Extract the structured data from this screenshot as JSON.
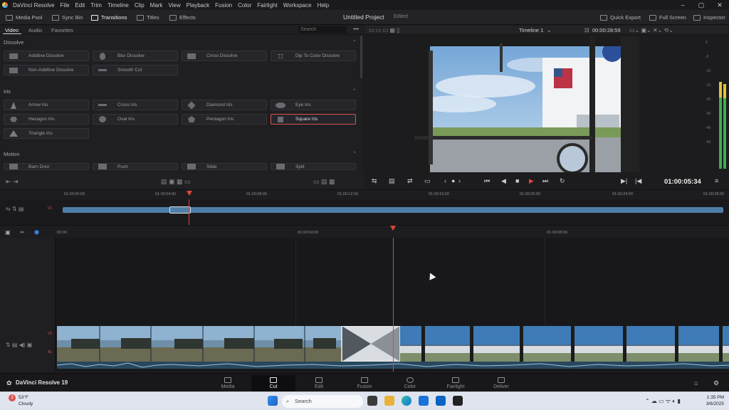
{
  "menubar": {
    "app_name": "DaVinci Resolve",
    "items": [
      "File",
      "Edit",
      "Trim",
      "Timeline",
      "Clip",
      "Mark",
      "View",
      "Playback",
      "Fusion",
      "Color",
      "Fairlight",
      "Workspace",
      "Help"
    ]
  },
  "toolbar": {
    "media_pool": "Media Pool",
    "sync_bin": "Sync Bin",
    "transitions": "Transitions",
    "titles": "Titles",
    "effects": "Effects",
    "project_title": "Untitled Project",
    "project_status": "Edited",
    "quick_export": "Quick Export",
    "full_screen": "Full Screen",
    "inspector": "Inspector"
  },
  "effects_panel": {
    "tabs": [
      "Video",
      "Audio",
      "Favorites"
    ],
    "search_placeholder": "Search",
    "sections": {
      "dissolve": "Dissolve",
      "iris": "Iris",
      "motion": "Motion"
    },
    "dissolve_items": [
      "Additive Dissolve",
      "Blur Dissolve",
      "Cross Dissolve",
      "Dip To Color Dissolve",
      "Non-Additive Dissolve",
      "Smooth Cut"
    ],
    "iris_items": [
      "Arrow Iris",
      "Cross Iris",
      "Diamond Iris",
      "Eye Iris",
      "Hexagon Iris",
      "Oval Iris",
      "Pentagon Iris",
      "Square Iris",
      "Triangle Iris"
    ],
    "motion_items": [
      "Barn Door",
      "Push",
      "Slide",
      "Split"
    ],
    "selected": "Square Iris"
  },
  "viewer": {
    "timeline_name": "Timeline 1",
    "duration": "00:00:28:59",
    "timecode": "01:00:05:34"
  },
  "meter": {
    "scale": [
      "0",
      "-5",
      "-10",
      "-15",
      "-20",
      "-30",
      "-40",
      "-50"
    ]
  },
  "ruler_upper": [
    "01:00:00:00",
    "01:00:04:00",
    "01:00:08:00",
    "01:00:12:00",
    "01:00:16:00",
    "01:00:20:00",
    "01:00:24:00",
    "01:00:28:00"
  ],
  "ruler_main": [
    "00:00",
    "01:00:04:00",
    "01:00:08:00"
  ],
  "tracks": {
    "v1": "V1",
    "a1": "A1"
  },
  "pages": {
    "brand": "DaVinci Resolve 19",
    "items": [
      "Media",
      "Cut",
      "Edit",
      "Fusion",
      "Color",
      "Fairlight",
      "Deliver"
    ],
    "active": "Cut"
  },
  "taskbar": {
    "weather_temp": "53°F",
    "weather_desc": "Cloudy",
    "weather_badge": "3",
    "search": "Search",
    "time": "1:35 PM",
    "date": "3/6/2025"
  },
  "colors": {
    "accent_red": "#e0443b",
    "clip_blue": "#4f7fa8"
  }
}
